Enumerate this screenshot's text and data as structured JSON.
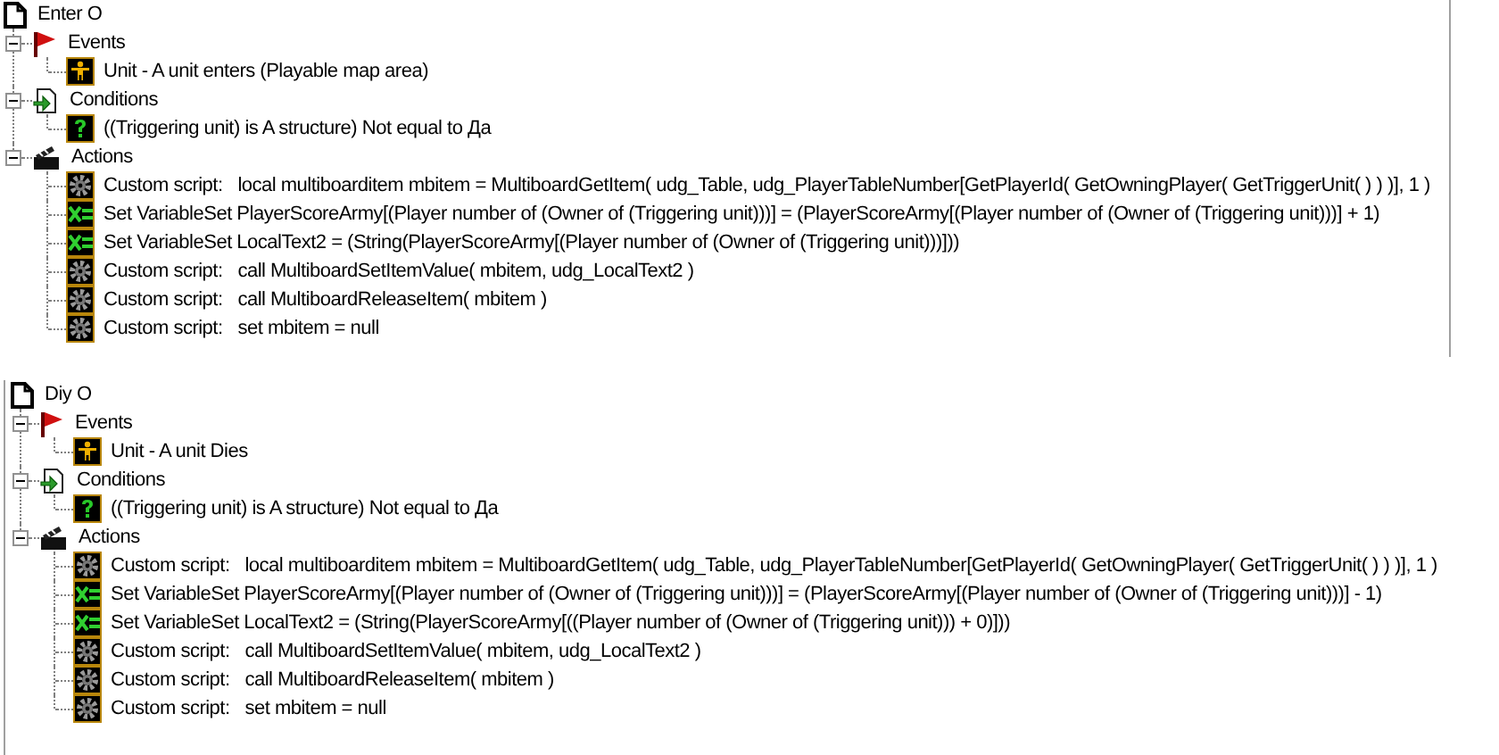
{
  "triggers": [
    {
      "title": "Enter O",
      "sections": [
        {
          "kind": "events",
          "label": "Events",
          "expanded": true,
          "items": [
            {
              "kind": "unit",
              "text": "Unit - A unit enters (Playable map area)"
            }
          ]
        },
        {
          "kind": "conditions",
          "label": "Conditions",
          "expanded": true,
          "items": [
            {
              "kind": "condition",
              "text": "((Triggering unit) is A structure) Not equal to Да"
            }
          ]
        },
        {
          "kind": "actions",
          "label": "Actions",
          "expanded": true,
          "items": [
            {
              "kind": "script",
              "text": "Custom script:   local multiboarditem mbitem = MultiboardGetItem( udg_Table, udg_PlayerTableNumber[GetPlayerId( GetOwningPlayer( GetTriggerUnit( ) ) )], 1 )"
            },
            {
              "kind": "set",
              "text": "Set VariableSet PlayerScoreArmy[(Player number of (Owner of (Triggering unit)))] = (PlayerScoreArmy[(Player number of (Owner of (Triggering unit)))] + 1)"
            },
            {
              "kind": "set",
              "text": "Set VariableSet LocalText2 = (String(PlayerScoreArmy[(Player number of (Owner of (Triggering unit)))]))"
            },
            {
              "kind": "script",
              "text": "Custom script:   call MultiboardSetItemValue( mbitem, udg_LocalText2 )"
            },
            {
              "kind": "script",
              "text": "Custom script:   call MultiboardReleaseItem( mbitem )"
            },
            {
              "kind": "script",
              "text": "Custom script:   set mbitem = null"
            }
          ]
        }
      ]
    },
    {
      "title": "Diy O",
      "sections": [
        {
          "kind": "events",
          "label": "Events",
          "expanded": true,
          "items": [
            {
              "kind": "unit",
              "text": "Unit - A unit Dies"
            }
          ]
        },
        {
          "kind": "conditions",
          "label": "Conditions",
          "expanded": true,
          "items": [
            {
              "kind": "condition",
              "text": "((Triggering unit) is A structure) Not equal to Да"
            }
          ]
        },
        {
          "kind": "actions",
          "label": "Actions",
          "expanded": true,
          "items": [
            {
              "kind": "script",
              "text": "Custom script:   local multiboarditem mbitem = MultiboardGetItem( udg_Table, udg_PlayerTableNumber[GetPlayerId( GetOwningPlayer( GetTriggerUnit( ) ) )], 1 )"
            },
            {
              "kind": "set",
              "text": "Set VariableSet PlayerScoreArmy[(Player number of (Owner of (Triggering unit)))] = (PlayerScoreArmy[(Player number of (Owner of (Triggering unit)))] - 1)"
            },
            {
              "kind": "set",
              "text": "Set VariableSet LocalText2 = (String(PlayerScoreArmy[((Player number of (Owner of (Triggering unit))) + 0)]))"
            },
            {
              "kind": "script",
              "text": "Custom script:   call MultiboardSetItemValue( mbitem, udg_LocalText2 )"
            },
            {
              "kind": "script",
              "text": "Custom script:   call MultiboardReleaseItem( mbitem )"
            },
            {
              "kind": "script",
              "text": "Custom script:   set mbitem = null"
            }
          ]
        }
      ]
    }
  ]
}
